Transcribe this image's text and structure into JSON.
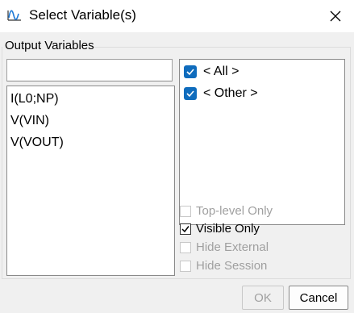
{
  "window": {
    "title": "Select Variable(s)"
  },
  "group": {
    "label": "Output Variables"
  },
  "filter": {
    "value": "",
    "placeholder": ""
  },
  "variables": [
    "I(L0;NP)",
    "V(VIN)",
    "V(VOUT)"
  ],
  "categories": [
    {
      "label": "< All >",
      "checked": true
    },
    {
      "label": "< Other >",
      "checked": true
    }
  ],
  "options": [
    {
      "label": "Top-level Only",
      "checked": false,
      "enabled": false
    },
    {
      "label": "Visible Only",
      "checked": true,
      "enabled": true
    },
    {
      "label": "Hide External",
      "checked": false,
      "enabled": false
    },
    {
      "label": "Hide Session",
      "checked": false,
      "enabled": false
    }
  ],
  "buttons": {
    "ok": "OK",
    "cancel": "Cancel",
    "ok_enabled": false
  },
  "colors": {
    "accent": "#0f6cbd",
    "disabled_text": "#a0a0a0"
  }
}
